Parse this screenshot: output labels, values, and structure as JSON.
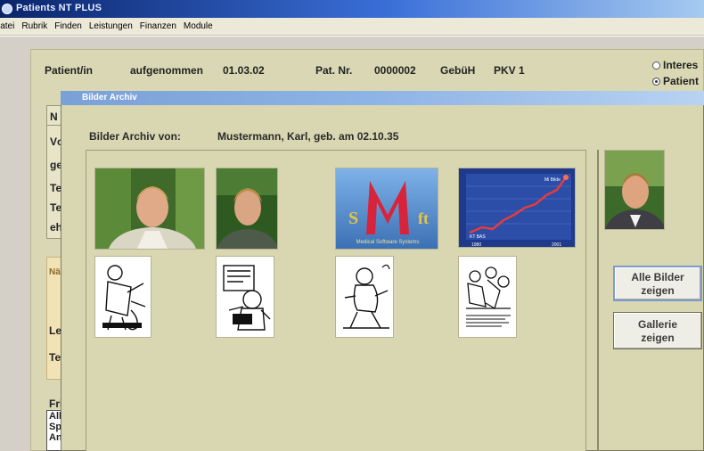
{
  "app": {
    "title": "Patients NT PLUS"
  },
  "menu": [
    {
      "label": "Datei"
    },
    {
      "label": "Rubrik"
    },
    {
      "label": "Finden"
    },
    {
      "label": "Leistungen"
    },
    {
      "label": "Finanzen"
    },
    {
      "label": "Module"
    }
  ],
  "patient": {
    "label": "Patient/in",
    "status": "aufgenommen",
    "date": "01.03.02",
    "pat_nr_label": "Pat. Nr.",
    "pat_nr": "0000002",
    "fee_label": "GebüH",
    "fee_value": "PKV 1",
    "radio_1": "Interes",
    "radio_2": "Patient"
  },
  "background_fragments": {
    "n": "N",
    "v": "Vc",
    "g": "ge",
    "t1": "Te",
    "t2": "Te",
    "e": "eh",
    "na": "Nä",
    "le": "Le",
    "te": "Te",
    "fr": "Fri",
    "list": [
      "All",
      "Sp",
      "An"
    ]
  },
  "dialog": {
    "title": "Bilder Archiv",
    "archiv_label": "Bilder Archiv von:",
    "patient_name": "Mustermann, Karl, geb. am 02.10.35",
    "logo_text": "Medical Software Systems",
    "chart_label_top": "Mi Bilde",
    "chart_label_left": "KT BAS",
    "chart_year_start": "1980",
    "chart_year_end": "2001",
    "buttons": {
      "all_images": "Alle Bilder zeigen",
      "all_images_line1": "Alle Bilder",
      "all_images_line2": "zeigen",
      "gallery": "Gallerie zeigen",
      "gallery_line1": "Gallerie",
      "gallery_line2": "zeigen"
    }
  },
  "colors": {
    "dialog_bg": "#d9d7b1",
    "title_bar": "#0a246a",
    "accent_red": "#d8243a"
  }
}
